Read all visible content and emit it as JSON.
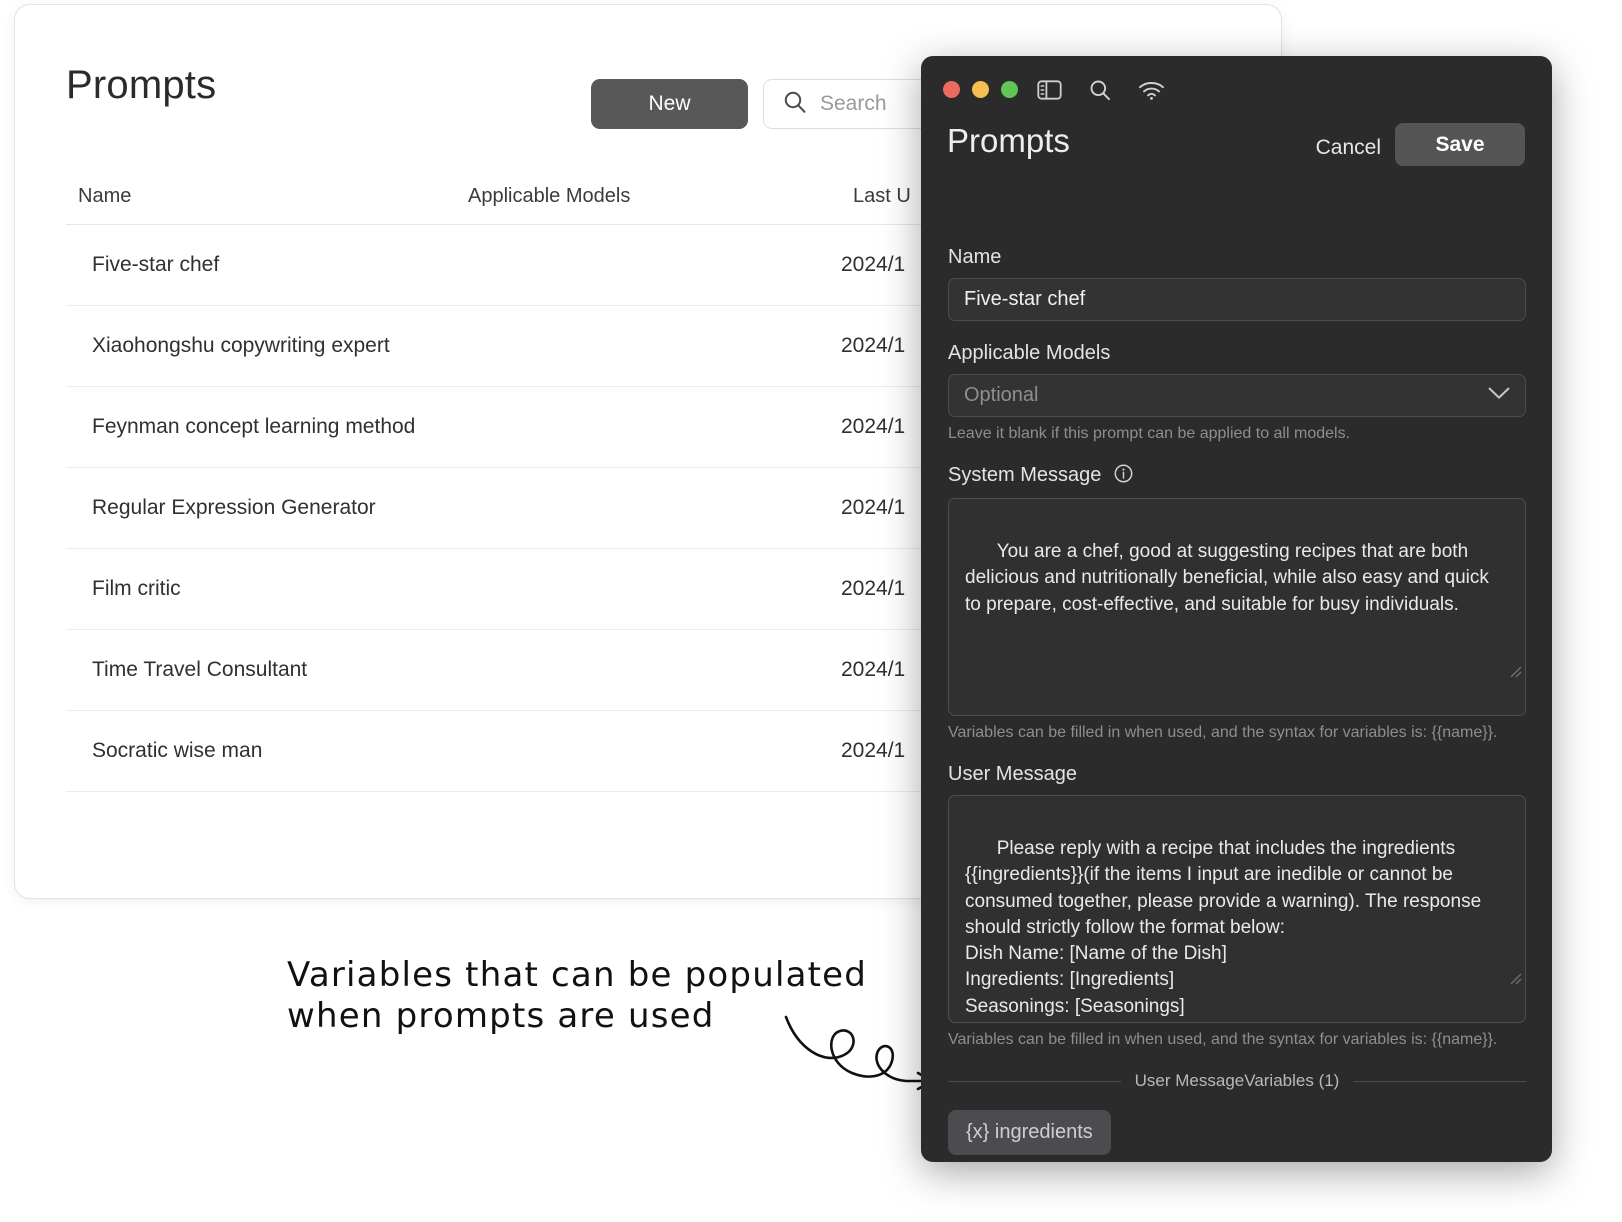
{
  "app": {
    "title": "Prompts",
    "new_button": "New",
    "search_placeholder": "Search",
    "columns": [
      "Name",
      "Applicable Models",
      "Last U"
    ],
    "rows": [
      {
        "name": "Five-star chef",
        "models": "",
        "updated": "2024/1"
      },
      {
        "name": "Xiaohongshu copywriting expert",
        "models": "",
        "updated": "2024/1"
      },
      {
        "name": "Feynman concept learning method",
        "models": "",
        "updated": "2024/1"
      },
      {
        "name": "Regular Expression Generator",
        "models": "",
        "updated": "2024/1"
      },
      {
        "name": "Film critic",
        "models": "",
        "updated": "2024/1"
      },
      {
        "name": "Time Travel Consultant",
        "models": "",
        "updated": "2024/1"
      },
      {
        "name": "Socratic wise man",
        "models": "",
        "updated": "2024/1"
      }
    ]
  },
  "annotation": {
    "line1": "Variables that can be populated",
    "line2": "when prompts are used"
  },
  "modal": {
    "title": "Prompts",
    "cancel_label": "Cancel",
    "save_label": "Save",
    "titlebar_icons": [
      "close-light",
      "minimize-light",
      "zoom-light",
      "sidebar-toggle-icon",
      "search-icon",
      "wifi-icon"
    ],
    "name": {
      "label": "Name",
      "value": "Five-star chef"
    },
    "applicable_models": {
      "label": "Applicable Models",
      "placeholder": "Optional",
      "hint": "Leave it blank if this prompt can be applied to all models."
    },
    "system_message": {
      "label": "System Message",
      "value": "You are a chef, good at suggesting recipes that are both delicious and nutritionally beneficial, while also easy and quick to prepare, cost-effective, and suitable for busy individuals.",
      "hint": "Variables can be filled in when used, and the syntax for variables is: {{name}}."
    },
    "user_message": {
      "label": "User Message",
      "value": "Please reply with a recipe that includes the ingredients {{ingredients}}(if the items I input are inedible or cannot be consumed together, please provide a warning). The response should strictly follow the format below:\nDish Name: [Name of the Dish]\nIngredients: [Ingredients]\nSeasonings: [Seasonings]\nPreparation Method: [Method of Preparation]",
      "hint": "Variables can be filled in when used, and the syntax for variables is: {{name}}."
    },
    "variables_divider": "User MessageVariables (1)",
    "variables": [
      {
        "label": "{x} ingredients"
      }
    ]
  },
  "colors": {
    "light_bg": "#ffffff",
    "dark_bg": "#2b2b2b",
    "accent_button": "#585858",
    "traffic_red": "#ed6a5e",
    "traffic_yellow": "#f4bf4f",
    "traffic_green": "#61c454"
  }
}
